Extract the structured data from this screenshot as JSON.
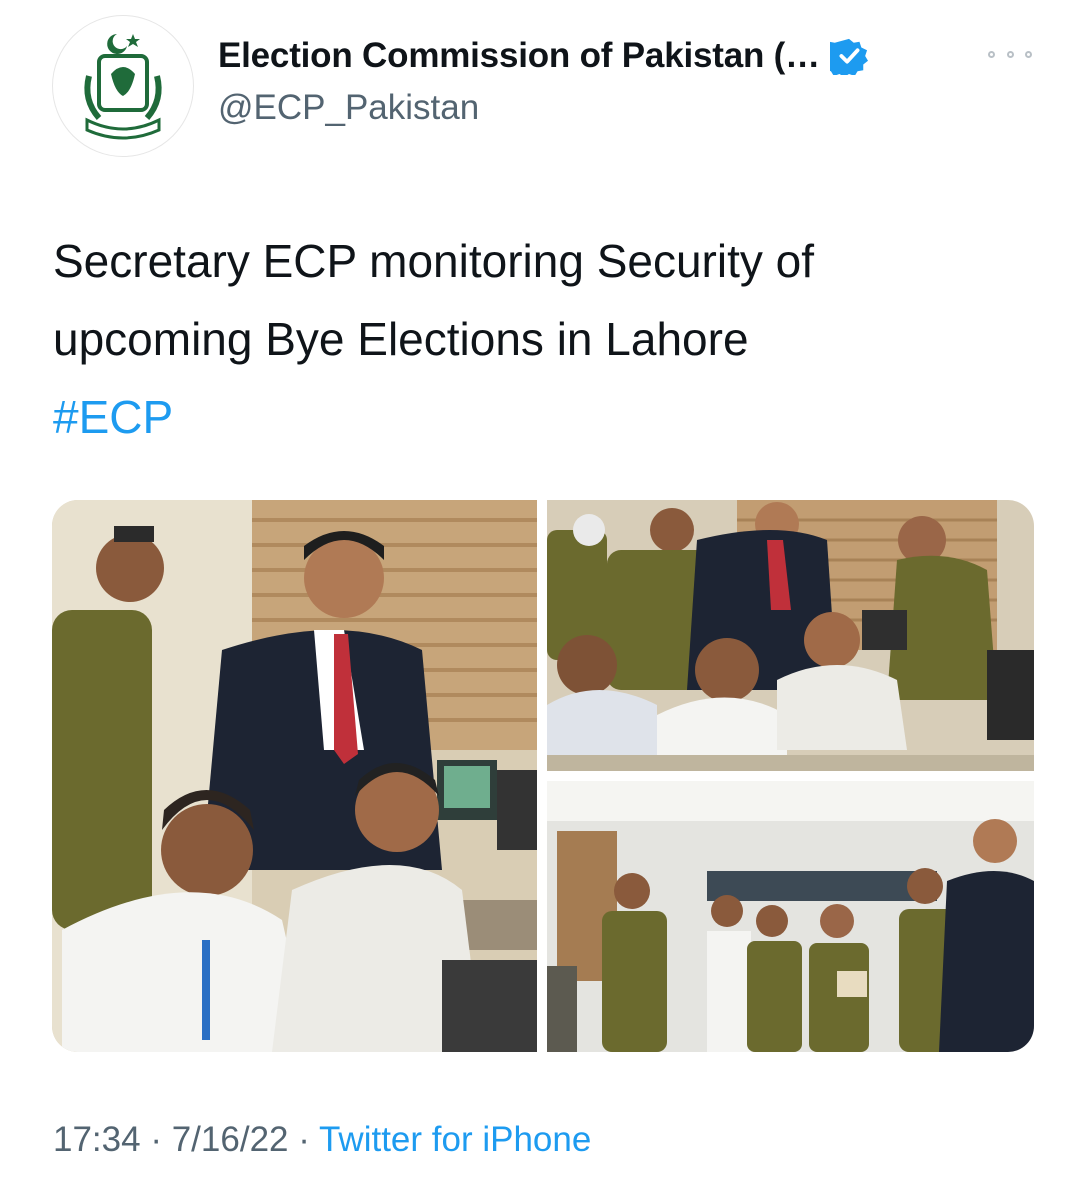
{
  "author": {
    "name": "Election Commission of Pakistan (…",
    "handle": "@ECP_Pakistan",
    "verified": true,
    "avatar_icon": "ecp-emblem-logo"
  },
  "tweet": {
    "text_line1": "Secretary ECP monitoring Security of",
    "text_line2": "upcoming Bye Elections in Lahore",
    "hashtag": "#ECP"
  },
  "media": {
    "photos": [
      {
        "description_icon": "photo-officials-at-monitoring-desk"
      },
      {
        "description_icon": "photo-police-officer-at-computer"
      },
      {
        "description_icon": "photo-control-room-briefing"
      }
    ]
  },
  "meta": {
    "time": "17:34",
    "date": "7/16/22",
    "separator": "·",
    "source": "Twitter for iPhone"
  },
  "colors": {
    "accent": "#1d9bf0",
    "text": "#0f1419",
    "secondary": "#536471",
    "uniform": "#6b6a2e",
    "emblem_green": "#1f6b3a"
  }
}
